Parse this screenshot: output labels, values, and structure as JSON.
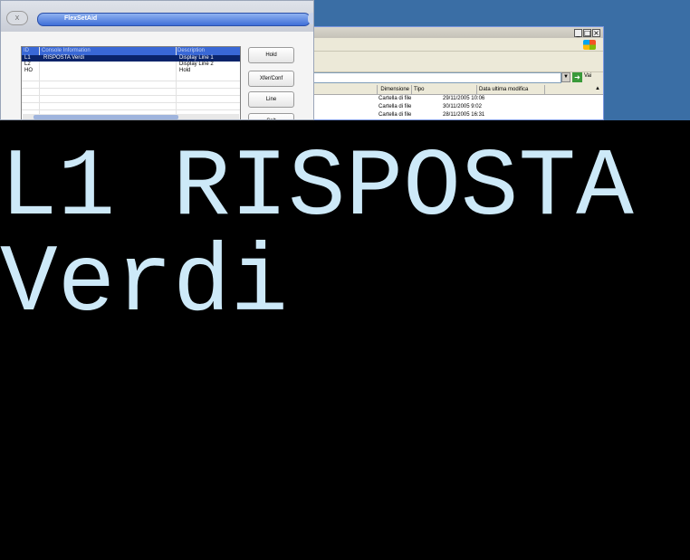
{
  "flexsetaid": {
    "title": "FlexSetAid",
    "close_label": "X",
    "list": {
      "headers": [
        "ID",
        "Console Information",
        "Description"
      ],
      "rows": [
        {
          "id": "L1",
          "info": "RISPOSTA Verdi",
          "desc": "Display Line 1",
          "selected": true
        },
        {
          "id": "L2",
          "info": "",
          "desc": "Display Line 2",
          "selected": false
        },
        {
          "id": "HO",
          "info": "",
          "desc": "Hold",
          "selected": false
        }
      ]
    },
    "buttons": [
      "Hold",
      "Xfer/Conf",
      "Line",
      "Splt"
    ]
  },
  "explorer": {
    "window_controls": [
      "_",
      "□",
      "×"
    ],
    "go_label": "Vai",
    "columns": [
      "Dimensione",
      "Tipo",
      "Data ultima modifica"
    ],
    "rows": [
      {
        "type": "Cartella di file",
        "date": "29/11/2005 10:06"
      },
      {
        "type": "Cartella di file",
        "date": "30/11/2005 9:02"
      },
      {
        "type": "Cartella di file",
        "date": "28/11/2005 16:31"
      }
    ]
  },
  "display": {
    "line1": "L1 RISPOSTA",
    "line2": "Verdi",
    "text_color": "#cde9f8",
    "background": "#000000"
  }
}
